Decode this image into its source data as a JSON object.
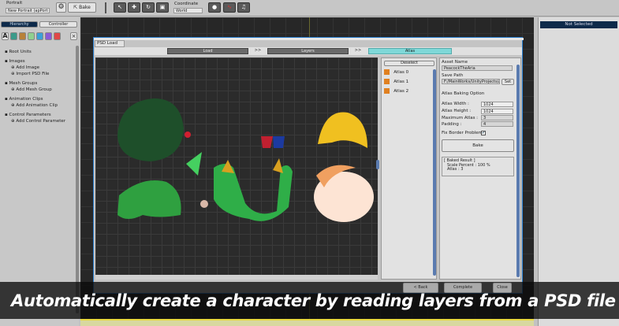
{
  "toolbar": {
    "portrait_label": "Portrait",
    "portrait_value": "New Portrait (apPort",
    "bake": "Bake",
    "coordinate_label": "Coordinate",
    "coordinate_value": "World"
  },
  "left": {
    "tabs": [
      "Hierarchy",
      "Controller"
    ],
    "tree": [
      {
        "label": "Root Units",
        "indent": 0
      },
      {
        "label": "Images",
        "indent": 0
      },
      {
        "label": "Add Image",
        "indent": 1
      },
      {
        "label": "Import PSD File",
        "indent": 1
      },
      {
        "label": "Mesh Groups",
        "indent": 0
      },
      {
        "label": "Add Mesh Group",
        "indent": 1
      },
      {
        "label": "Animation Clips",
        "indent": 0
      },
      {
        "label": "Add Animation Clip",
        "indent": 1
      },
      {
        "label": "Control Parameters",
        "indent": 0
      },
      {
        "label": "Add Control Parameter",
        "indent": 1
      }
    ]
  },
  "right": {
    "header": "Not Selected"
  },
  "dialog": {
    "title": "PSD Load",
    "steps": [
      "Load",
      ">>",
      "Layers",
      ">>",
      "Atlas"
    ],
    "active_step": "Atlas",
    "deselect": "Deselect",
    "atlases": [
      "Atlas 0",
      "Atlas 1",
      "Atlas 2"
    ],
    "asset_name_label": "Asset Name",
    "asset_name": "PeacockTheAria",
    "save_path_label": "Save Path",
    "save_path": "F:/MainWorks/UnityProjects/Ar",
    "set": "Set",
    "baking_option": "Atlas Baking Option",
    "atlas_width_label": "Atlas Width :",
    "atlas_width": "1024",
    "atlas_height_label": "Atlas Height :",
    "atlas_height": "1024",
    "max_atlas_label": "Maximum Atlas :",
    "max_atlas": "3",
    "padding_label": "Padding :",
    "padding": "4",
    "fix_border_label": "Fix Border Problem",
    "fix_border": true,
    "bake": "Bake",
    "result": [
      "[ Baked Result ]",
      "Scale Percent : 100 %",
      "Atlas : 3"
    ],
    "back": "< Back",
    "complete": "Complete",
    "close": "Close"
  },
  "caption": "Automatically create a character by reading layers from a PSD file",
  "colors": {
    "active_tab": "#7fd8d8",
    "hierarchy_tab": "#0d2a4a",
    "accent_border": "#2a7fd0"
  }
}
